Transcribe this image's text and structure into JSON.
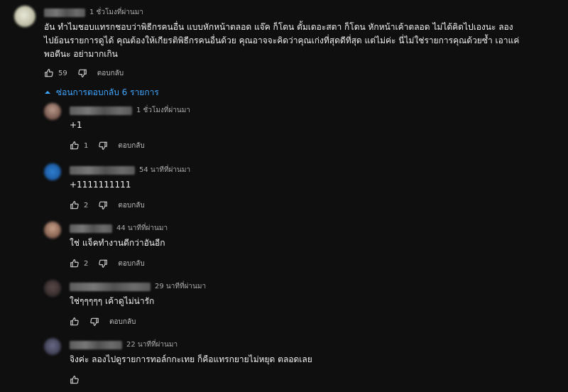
{
  "main_comment": {
    "time": "1 ชั่วโมงที่ผ่านมา",
    "lines": [
      "อัน ทำไมชอบแทรกชอบว่าพิธีกรคนอื่น แบบหักหน้าตลอด แจ๊ค ก็โดน ตั้มเดอะสตา ก็โดน หักหน้าเค้าตลอด ไม่ได้คิดไปเองนะ ลอง",
      "ไปย้อนรายการดูได้ คุณต้องให้เกียรติพิธีกรคนอื่นด้วย คุณอาจจะคิดว่าคุณเก่งที่สุดดีที่สุด แต่ไม่ค่ะ นี่ไม่ใช่รายการคุณด้วยซ้ำ เอาแค่",
      "พอดีนะ อย่ามากเกิน"
    ],
    "likes": "59",
    "reply_label": "ตอบกลับ"
  },
  "replies_toggle": {
    "label": "ซ่อนการตอบกลับ 6 รายการ"
  },
  "replies": [
    {
      "time": "1 ชั่วโมงที่ผ่านมา",
      "text": "+1",
      "likes": "1",
      "reply_label": "ตอบกลับ"
    },
    {
      "time": "54 นาทีที่ผ่านมา",
      "text": "+1111111111",
      "likes": "2",
      "reply_label": "ตอบกลับ"
    },
    {
      "time": "44 นาทีที่ผ่านมา",
      "text": "ใช่ แจ็คทำงานดีกว่าอันอีก",
      "likes": "2",
      "reply_label": "ตอบกลับ"
    },
    {
      "time": "29 นาทีที่ผ่านมา",
      "text": "ใช่ๆๆๆๆๆ เค้าดูไม่น่ารัก",
      "likes": "",
      "reply_label": "ตอบกลับ"
    },
    {
      "time": "22 นาทีที่ผ่านมา",
      "text": "จิงค่ะ ลองไปดูรายการทอล์กกะเทย ก็คือแทรกยายไม่หยุด ตลอดเลย",
      "likes": "",
      "reply_label": ""
    }
  ],
  "icons": {
    "like": "thumbs-up-icon",
    "dislike": "thumbs-down-icon",
    "toggle": "chevron-up-icon"
  },
  "colors": {
    "background": "#0f0f0f",
    "link": "#3ea6ff",
    "text": "#f1f1f1",
    "muted": "#aaaaaa"
  }
}
